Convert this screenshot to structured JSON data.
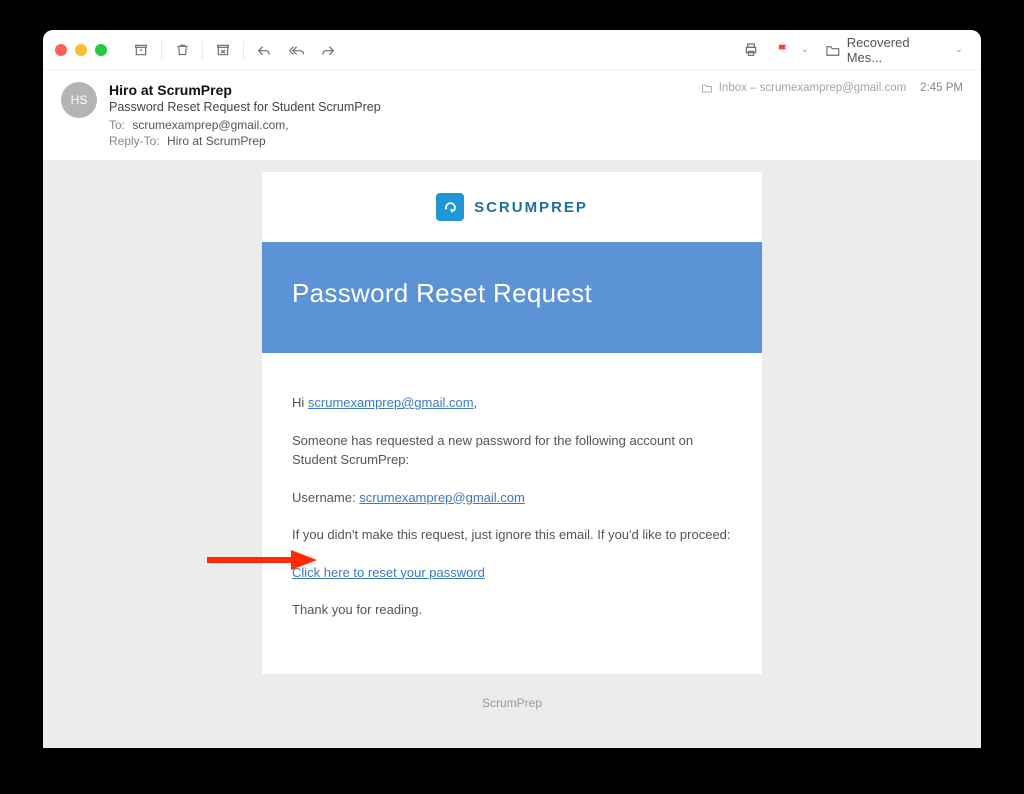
{
  "toolbar": {
    "folder_label": "Recovered Mes..."
  },
  "header": {
    "avatar_initials": "HS",
    "from": "Hiro at ScrumPrep",
    "subject": "Password Reset Request for Student ScrumPrep",
    "to_label": "To:",
    "to_value": "scrumexamprep@gmail.com,",
    "reply_label": "Reply-To:",
    "reply_value": "Hiro at ScrumPrep",
    "inbox_label": "Inbox – scrumexamprep@gmail.com",
    "time": "2:45 PM"
  },
  "email": {
    "brand_name": "SCRUMPREP",
    "banner_title": "Password Reset Request",
    "greeting_prefix": "Hi ",
    "greeting_email": "scrumexamprep@gmail.com",
    "greeting_suffix": ",",
    "line1": "Someone has requested a new password for the following account on Student ScrumPrep:",
    "username_label": "Username: ",
    "username_value": "scrumexamprep@gmail.com",
    "line2": "If you didn't make this request, just ignore this email. If you'd like to proceed:",
    "reset_link": "Click here to reset your password",
    "thanks": "Thank you for reading.",
    "footer": "ScrumPrep"
  }
}
